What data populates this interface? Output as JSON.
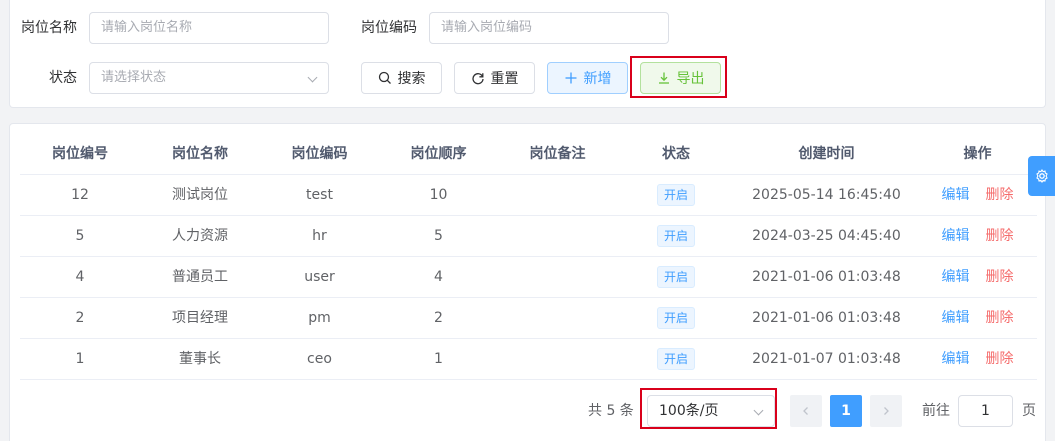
{
  "search": {
    "post_name_label": "岗位名称",
    "post_name_placeholder": "请输入岗位名称",
    "post_code_label": "岗位编码",
    "post_code_placeholder": "请输入岗位编码",
    "status_label": "状态",
    "status_placeholder": "请选择状态"
  },
  "buttons": {
    "search": "搜索",
    "reset": "重置",
    "add": "新增",
    "export": "导出"
  },
  "table": {
    "headers": [
      "岗位编号",
      "岗位名称",
      "岗位编码",
      "岗位顺序",
      "岗位备注",
      "状态",
      "创建时间",
      "操作"
    ],
    "rows": [
      {
        "id": "12",
        "name": "测试岗位",
        "code": "test",
        "order": "10",
        "remark": "",
        "status": "开启",
        "created": "2025-05-14 16:45:40"
      },
      {
        "id": "5",
        "name": "人力资源",
        "code": "hr",
        "order": "5",
        "remark": "",
        "status": "开启",
        "created": "2024-03-25 04:45:40"
      },
      {
        "id": "4",
        "name": "普通员工",
        "code": "user",
        "order": "4",
        "remark": "",
        "status": "开启",
        "created": "2021-01-06 01:03:48"
      },
      {
        "id": "2",
        "name": "项目经理",
        "code": "pm",
        "order": "2",
        "remark": "",
        "status": "开启",
        "created": "2021-01-06 01:03:48"
      },
      {
        "id": "1",
        "name": "董事长",
        "code": "ceo",
        "order": "1",
        "remark": "",
        "status": "开启",
        "created": "2021-01-07 01:03:48"
      }
    ],
    "edit_label": "编辑",
    "delete_label": "删除"
  },
  "pagination": {
    "total": "共 5 条",
    "page_size": "100条/页",
    "current_page": "1",
    "goto_label": "前往",
    "goto_value": "1",
    "page_suffix": "页"
  },
  "colors": {
    "primary": "#409eff",
    "success": "#67c23a",
    "danger": "#f56c6c",
    "highlight": "#d9001b"
  }
}
